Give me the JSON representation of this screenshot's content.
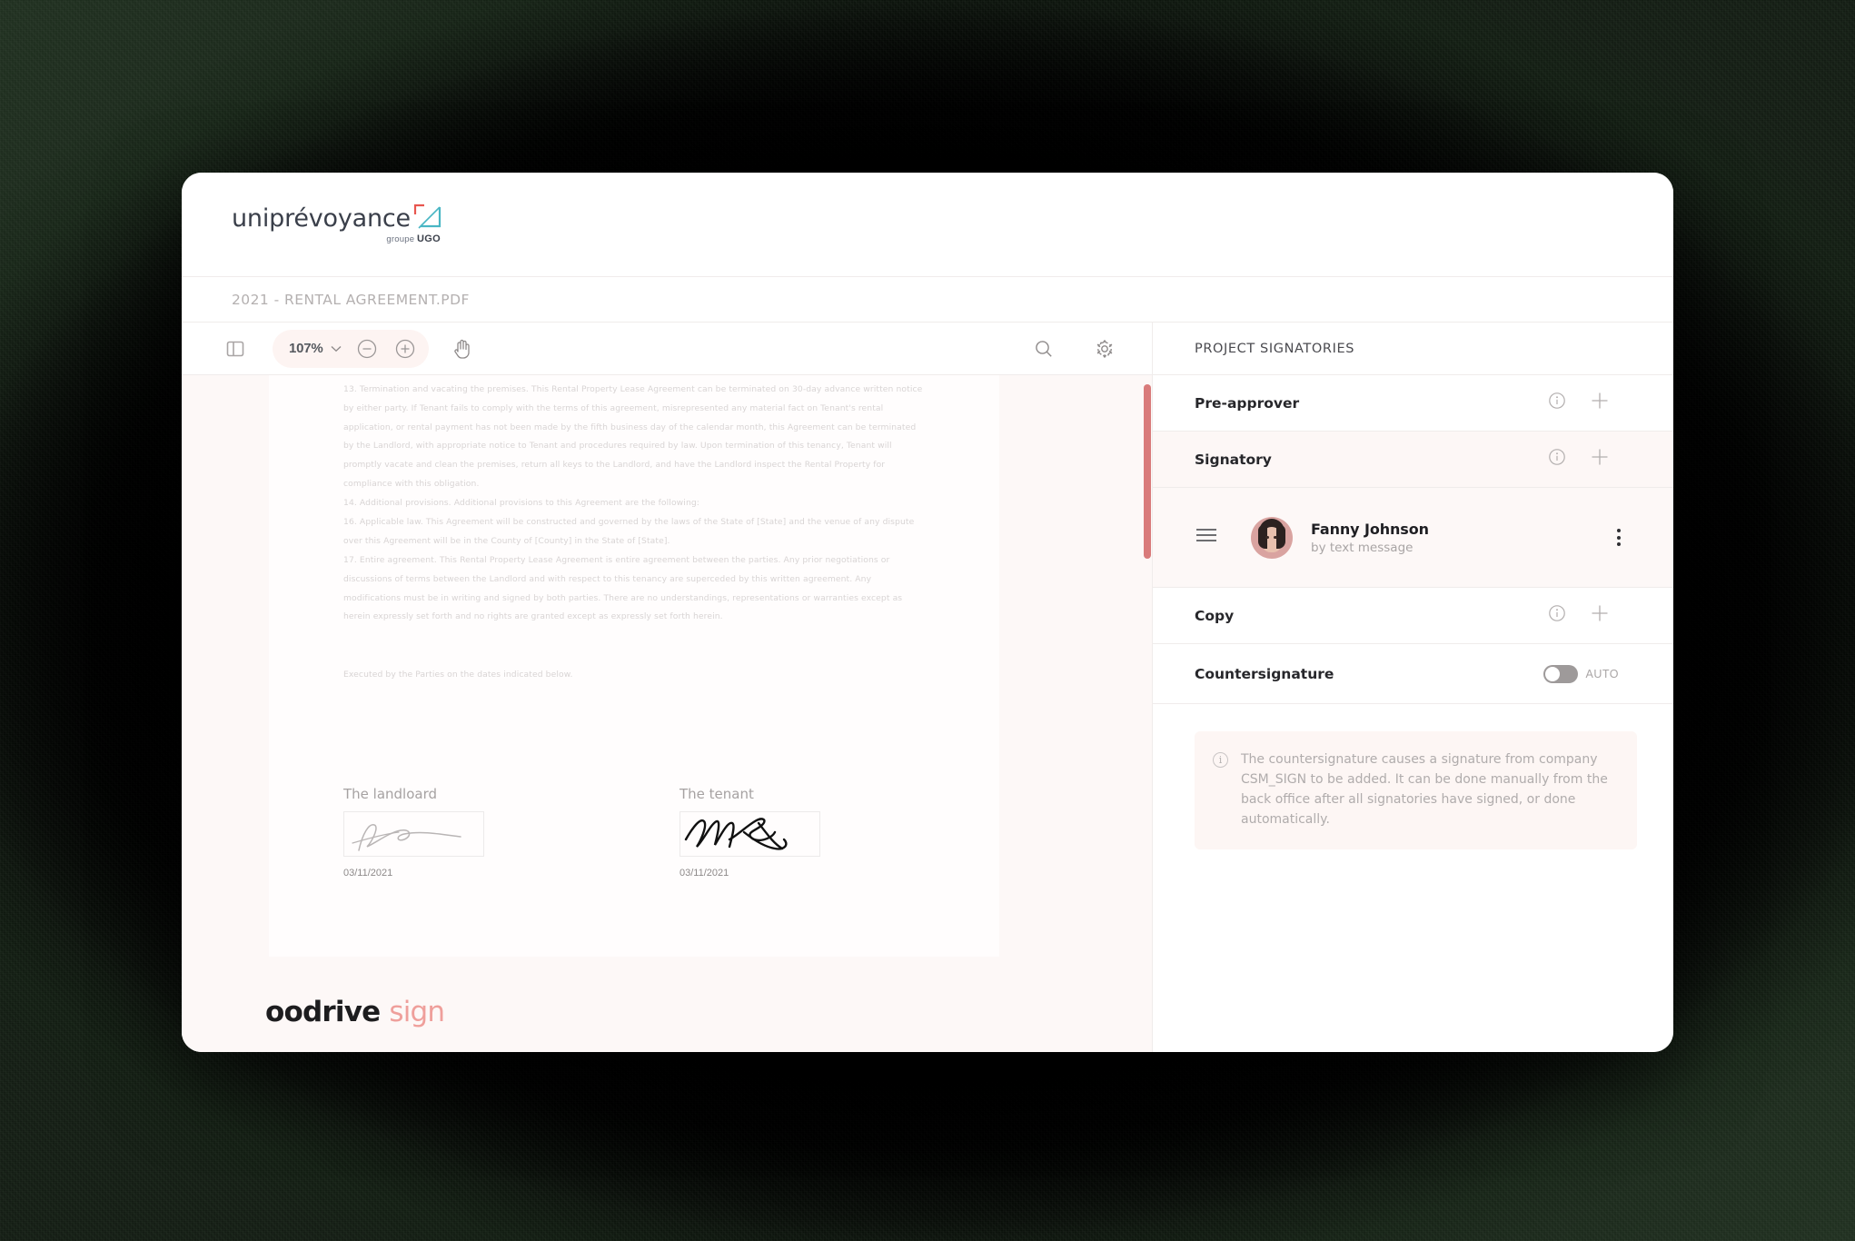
{
  "brand": {
    "name": "uniprévoyance",
    "sub_prefix": "groupe",
    "sub_bold": "UGO",
    "mark_colors": {
      "corner_top": "#e8564f",
      "corner_bottom": "#49b6c4"
    }
  },
  "document": {
    "title": "2021 - RENTAL AGREEMENT.PDF",
    "paragraphs": [
      "13. Termination and vacating the premises.  This Rental Property Lease Agreement can be terminated on 30-day advance written notice by either party.  If Tenant fails to comply with the terms of this agreement, misrepresented any material fact on Tenant's rental application, or rental payment has not been made by the fifth business day of the calendar month, this Agreement can be terminated by the Landlord, with appropriate notice to Tenant and procedures required by law.  Upon termination of this tenancy, Tenant will promptly vacate and clean the premises, return all keys to the Landlord, and have the Landlord inspect the Rental Property for compliance with this obligation.",
      "14. Additional provisions.  Additional provisions to this Agreement are the following:",
      "16. Applicable law.  This Agreement will be constructed and governed by the laws of the State of [State] and the venue of any dispute over this Agreement will be in the County of [County] in the State of [State].",
      "17. Entire agreement.  This Rental Property Lease Agreement is entire agreement between the parties.  Any prior negotiations or discussions of terms between the Landlord and with respect to this tenancy are superceded by this written agreement. Any modifications must be in writing and signed by both parties. There are no understandings, representations or warranties except as herein expressly set forth and no rights are granted except as expressly set forth herein."
    ],
    "executed_line": "Executed by the Parties on the dates indicated below.",
    "signatures": [
      {
        "label": "The landloard",
        "date": "03/11/2021"
      },
      {
        "label": "The tenant",
        "date": "03/11/2021"
      }
    ]
  },
  "toolbar": {
    "panel_toggle_icon": "sidebar-panel-icon",
    "zoom_level": "107%",
    "zoom_out_icon": "minus-circle-icon",
    "zoom_in_icon": "plus-circle-icon",
    "hand_icon": "hand-tool-icon",
    "search_icon": "search-icon",
    "settings_icon": "gear-icon"
  },
  "footer": {
    "brand_dark": "oodrive",
    "brand_light": "sign"
  },
  "panel": {
    "header": "PROJECT SIGNATORIES",
    "rows": [
      {
        "label": "Pre-approver"
      },
      {
        "label": "Signatory"
      },
      {
        "label": "Copy"
      }
    ],
    "signatory": {
      "name": "Fanny Johnson",
      "method": "by text message",
      "drag_icon": "drag-handle-icon",
      "menu_icon": "kebab-menu-icon"
    },
    "countersignature": {
      "label": "Countersignature",
      "toggle_label": "AUTO",
      "toggle_state": "off",
      "info": "The countersignature causes a signature from company CSM_SIGN to be added. It can be done manually from the back office after all signatories have signed, or done automatically."
    }
  },
  "colors": {
    "accent": "#ef9f9b",
    "scrollbar": "#d97b7b",
    "panel_tint": "#fdf7f6"
  }
}
